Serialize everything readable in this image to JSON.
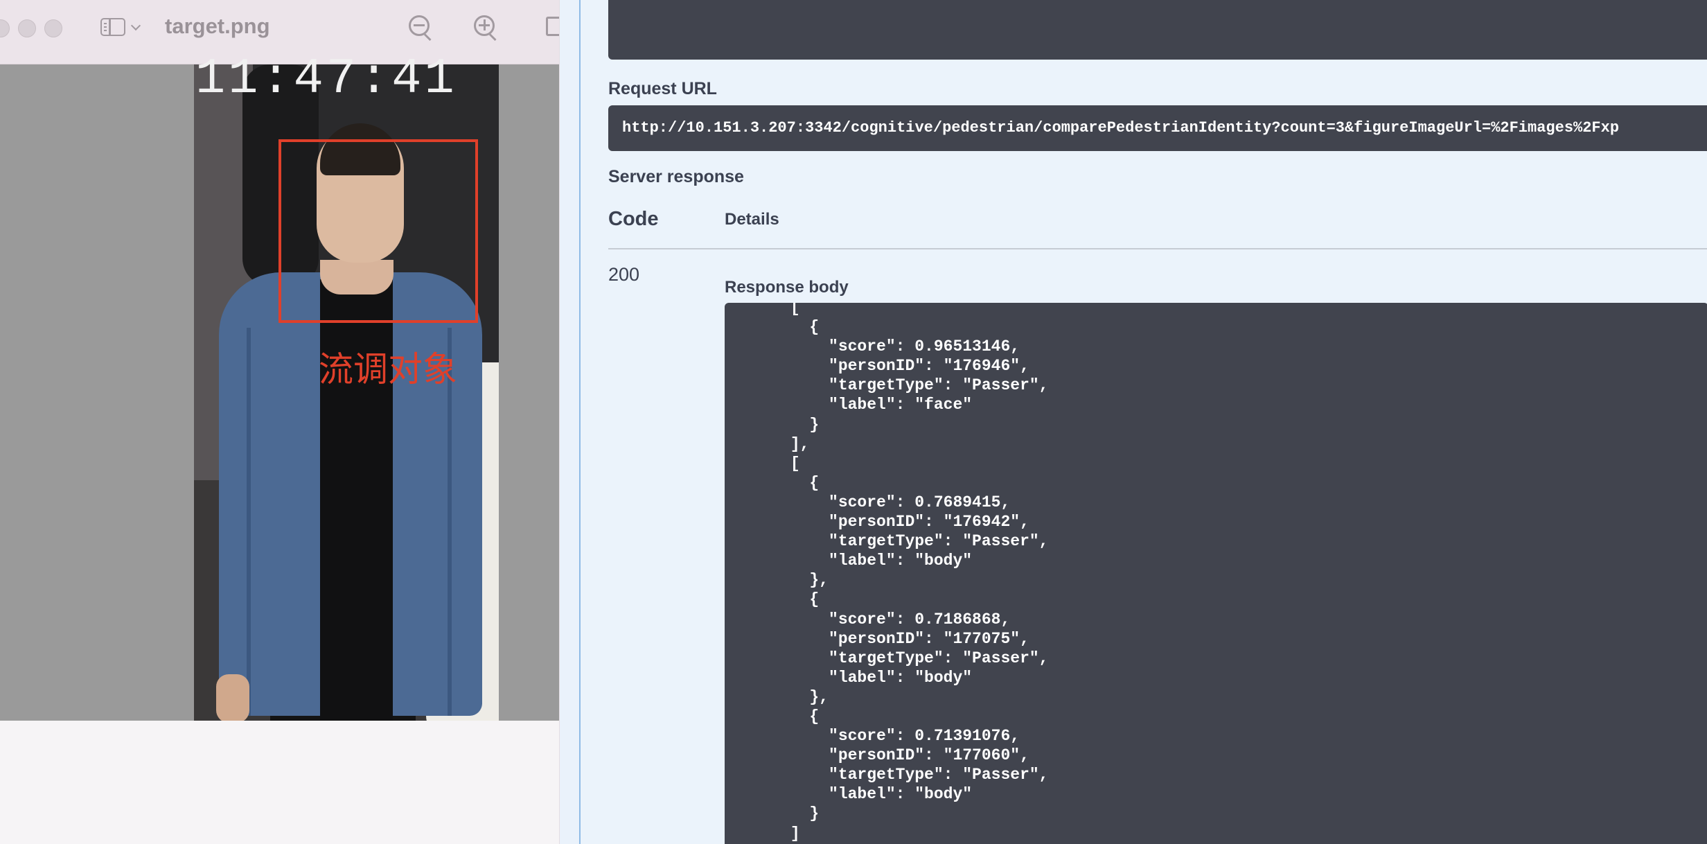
{
  "preview": {
    "title": "target.png",
    "timestamp_overlay": "11:47:41",
    "detection_label": "流调对象",
    "icons": [
      "sidebar-icon",
      "chevron-down-icon",
      "zoom-out-icon",
      "zoom-in-icon",
      "share-icon"
    ]
  },
  "swagger": {
    "request_url_label": "Request URL",
    "request_url": "http://10.151.3.207:3342/cognitive/pedestrian/comparePedestrianIdentity?count=3&figureImageUrl=%2Fimages%2Fxp",
    "server_response_label": "Server response",
    "columns": {
      "code": "Code",
      "details": "Details"
    },
    "response": {
      "code": "200",
      "body_label": "Response body",
      "body_lines": [
        "      [",
        "        {",
        "          \"score\": 0.96513146,",
        "          \"personID\": \"176946\",",
        "          \"targetType\": \"Passer\",",
        "          \"label\": \"face\"",
        "        }",
        "      ],",
        "      [",
        "        {",
        "          \"score\": 0.7689415,",
        "          \"personID\": \"176942\",",
        "          \"targetType\": \"Passer\",",
        "          \"label\": \"body\"",
        "        },",
        "        {",
        "          \"score\": 0.7186868,",
        "          \"personID\": \"177075\",",
        "          \"targetType\": \"Passer\",",
        "          \"label\": \"body\"",
        "        },",
        "        {",
        "          \"score\": 0.71391076,",
        "          \"personID\": \"177060\",",
        "          \"targetType\": \"Passer\",",
        "          \"label\": \"body\"",
        "        }",
        "      ]"
      ]
    }
  },
  "colors": {
    "code_block_bg": "#41444e",
    "panel_bg": "#ebf3fb",
    "detection_red": "#e0402a",
    "heading_text": "#3b4151"
  }
}
